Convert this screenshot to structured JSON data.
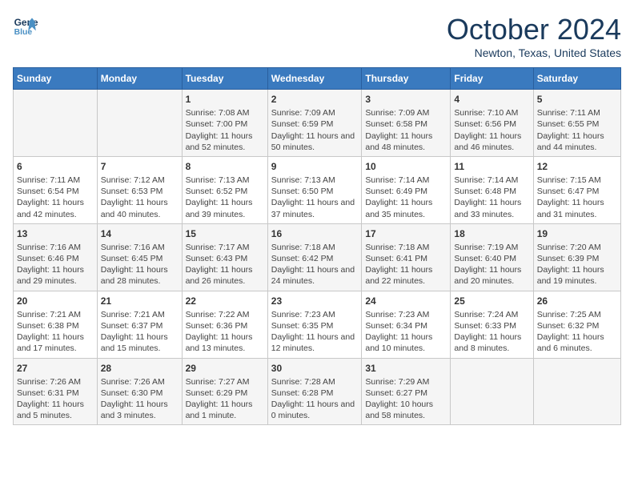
{
  "header": {
    "logo_line1": "General",
    "logo_line2": "Blue",
    "month": "October 2024",
    "location": "Newton, Texas, United States"
  },
  "days_of_week": [
    "Sunday",
    "Monday",
    "Tuesday",
    "Wednesday",
    "Thursday",
    "Friday",
    "Saturday"
  ],
  "weeks": [
    [
      {
        "day": "",
        "content": ""
      },
      {
        "day": "",
        "content": ""
      },
      {
        "day": "1",
        "content": "Sunrise: 7:08 AM\nSunset: 7:00 PM\nDaylight: 11 hours and 52 minutes."
      },
      {
        "day": "2",
        "content": "Sunrise: 7:09 AM\nSunset: 6:59 PM\nDaylight: 11 hours and 50 minutes."
      },
      {
        "day": "3",
        "content": "Sunrise: 7:09 AM\nSunset: 6:58 PM\nDaylight: 11 hours and 48 minutes."
      },
      {
        "day": "4",
        "content": "Sunrise: 7:10 AM\nSunset: 6:56 PM\nDaylight: 11 hours and 46 minutes."
      },
      {
        "day": "5",
        "content": "Sunrise: 7:11 AM\nSunset: 6:55 PM\nDaylight: 11 hours and 44 minutes."
      }
    ],
    [
      {
        "day": "6",
        "content": "Sunrise: 7:11 AM\nSunset: 6:54 PM\nDaylight: 11 hours and 42 minutes."
      },
      {
        "day": "7",
        "content": "Sunrise: 7:12 AM\nSunset: 6:53 PM\nDaylight: 11 hours and 40 minutes."
      },
      {
        "day": "8",
        "content": "Sunrise: 7:13 AM\nSunset: 6:52 PM\nDaylight: 11 hours and 39 minutes."
      },
      {
        "day": "9",
        "content": "Sunrise: 7:13 AM\nSunset: 6:50 PM\nDaylight: 11 hours and 37 minutes."
      },
      {
        "day": "10",
        "content": "Sunrise: 7:14 AM\nSunset: 6:49 PM\nDaylight: 11 hours and 35 minutes."
      },
      {
        "day": "11",
        "content": "Sunrise: 7:14 AM\nSunset: 6:48 PM\nDaylight: 11 hours and 33 minutes."
      },
      {
        "day": "12",
        "content": "Sunrise: 7:15 AM\nSunset: 6:47 PM\nDaylight: 11 hours and 31 minutes."
      }
    ],
    [
      {
        "day": "13",
        "content": "Sunrise: 7:16 AM\nSunset: 6:46 PM\nDaylight: 11 hours and 29 minutes."
      },
      {
        "day": "14",
        "content": "Sunrise: 7:16 AM\nSunset: 6:45 PM\nDaylight: 11 hours and 28 minutes."
      },
      {
        "day": "15",
        "content": "Sunrise: 7:17 AM\nSunset: 6:43 PM\nDaylight: 11 hours and 26 minutes."
      },
      {
        "day": "16",
        "content": "Sunrise: 7:18 AM\nSunset: 6:42 PM\nDaylight: 11 hours and 24 minutes."
      },
      {
        "day": "17",
        "content": "Sunrise: 7:18 AM\nSunset: 6:41 PM\nDaylight: 11 hours and 22 minutes."
      },
      {
        "day": "18",
        "content": "Sunrise: 7:19 AM\nSunset: 6:40 PM\nDaylight: 11 hours and 20 minutes."
      },
      {
        "day": "19",
        "content": "Sunrise: 7:20 AM\nSunset: 6:39 PM\nDaylight: 11 hours and 19 minutes."
      }
    ],
    [
      {
        "day": "20",
        "content": "Sunrise: 7:21 AM\nSunset: 6:38 PM\nDaylight: 11 hours and 17 minutes."
      },
      {
        "day": "21",
        "content": "Sunrise: 7:21 AM\nSunset: 6:37 PM\nDaylight: 11 hours and 15 minutes."
      },
      {
        "day": "22",
        "content": "Sunrise: 7:22 AM\nSunset: 6:36 PM\nDaylight: 11 hours and 13 minutes."
      },
      {
        "day": "23",
        "content": "Sunrise: 7:23 AM\nSunset: 6:35 PM\nDaylight: 11 hours and 12 minutes."
      },
      {
        "day": "24",
        "content": "Sunrise: 7:23 AM\nSunset: 6:34 PM\nDaylight: 11 hours and 10 minutes."
      },
      {
        "day": "25",
        "content": "Sunrise: 7:24 AM\nSunset: 6:33 PM\nDaylight: 11 hours and 8 minutes."
      },
      {
        "day": "26",
        "content": "Sunrise: 7:25 AM\nSunset: 6:32 PM\nDaylight: 11 hours and 6 minutes."
      }
    ],
    [
      {
        "day": "27",
        "content": "Sunrise: 7:26 AM\nSunset: 6:31 PM\nDaylight: 11 hours and 5 minutes."
      },
      {
        "day": "28",
        "content": "Sunrise: 7:26 AM\nSunset: 6:30 PM\nDaylight: 11 hours and 3 minutes."
      },
      {
        "day": "29",
        "content": "Sunrise: 7:27 AM\nSunset: 6:29 PM\nDaylight: 11 hours and 1 minute."
      },
      {
        "day": "30",
        "content": "Sunrise: 7:28 AM\nSunset: 6:28 PM\nDaylight: 11 hours and 0 minutes."
      },
      {
        "day": "31",
        "content": "Sunrise: 7:29 AM\nSunset: 6:27 PM\nDaylight: 10 hours and 58 minutes."
      },
      {
        "day": "",
        "content": ""
      },
      {
        "day": "",
        "content": ""
      }
    ]
  ]
}
